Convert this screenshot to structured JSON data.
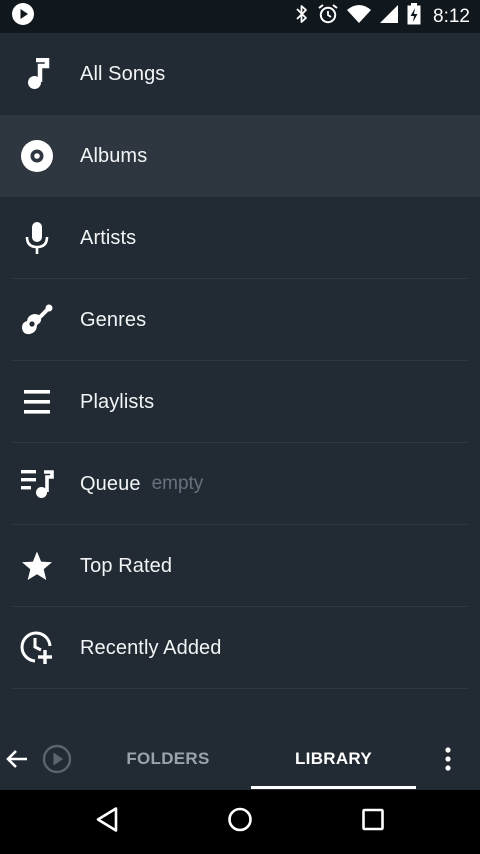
{
  "status_bar": {
    "time": "8:12",
    "icons": [
      "play-notification-icon",
      "bluetooth-icon",
      "alarm-icon",
      "wifi-icon",
      "cell-signal-icon",
      "battery-charging-icon"
    ]
  },
  "library_items": [
    {
      "label": "All Songs",
      "icon": "music-note-icon",
      "sublabel": ""
    },
    {
      "label": "Albums",
      "icon": "album-disc-icon",
      "sublabel": "",
      "selected": true
    },
    {
      "label": "Artists",
      "icon": "microphone-icon",
      "sublabel": ""
    },
    {
      "label": "Genres",
      "icon": "guitar-icon",
      "sublabel": ""
    },
    {
      "label": "Playlists",
      "icon": "playlist-icon",
      "sublabel": ""
    },
    {
      "label": "Queue",
      "icon": "queue-music-icon",
      "sublabel": "empty"
    },
    {
      "label": "Top Rated",
      "icon": "star-icon",
      "sublabel": ""
    },
    {
      "label": "Recently Added",
      "icon": "clock-add-icon",
      "sublabel": ""
    }
  ],
  "bottom_bar": {
    "tabs": [
      {
        "label": "FOLDERS",
        "active": false
      },
      {
        "label": "LIBRARY",
        "active": true
      }
    ]
  },
  "colors": {
    "background": "#222b33",
    "selected_row": "#2e3740",
    "status_bar": "#10171d",
    "sublabel": "#66727c",
    "inactive_tab": "#9aa3ab"
  }
}
